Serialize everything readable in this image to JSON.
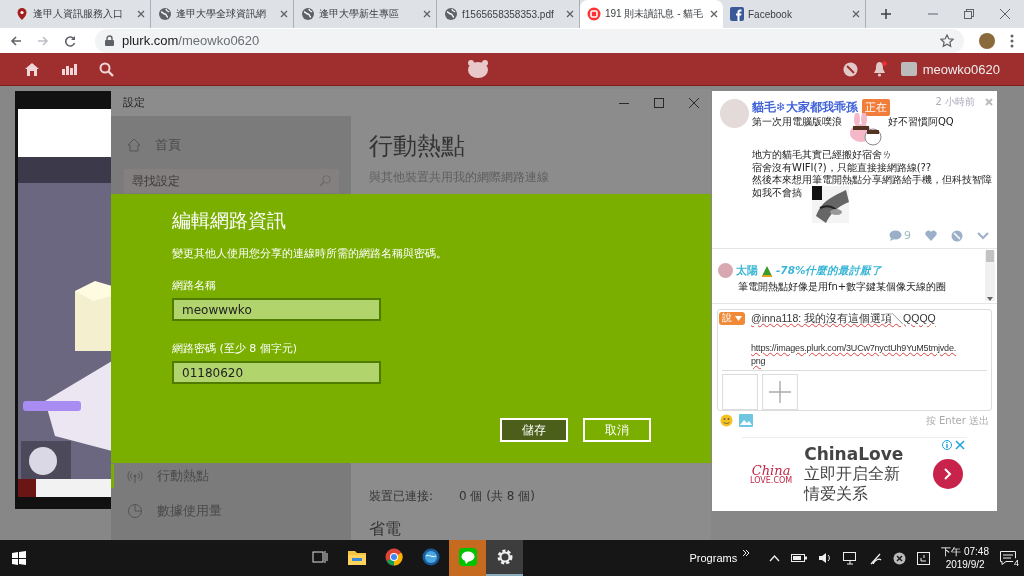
{
  "browser": {
    "tabs": [
      {
        "kind": "pin",
        "title": "逢甲人資訊服務入口",
        "selected": false
      },
      {
        "kind": "globe",
        "title": "逢甲大學全球資訊網",
        "selected": false
      },
      {
        "kind": "globe",
        "title": "逢甲大學新生專區",
        "selected": false
      },
      {
        "kind": "globe",
        "title": "f1565658358353.pdf",
        "selected": false
      },
      {
        "kind": "plurk",
        "title": "191 則未讀訊息 - 貓毛",
        "selected": true
      },
      {
        "kind": "facebook",
        "title": "Facebook",
        "selected": false
      }
    ],
    "address": {
      "host": "plurk.com",
      "path": "/meowko0620"
    }
  },
  "plurk_nav": {
    "username": "meowko0620"
  },
  "settings": {
    "title": "設定",
    "home": "首頁",
    "search_placeholder": "尋找設定",
    "nav_items": [
      {
        "kind": "hotspot",
        "label": "行動熱點",
        "selected": true
      },
      {
        "kind": "data",
        "label": "數據使用量",
        "selected": false
      }
    ],
    "page_title": "行動熱點",
    "page_subtitle": "與其他裝置共用我的網際網路連線",
    "connected_label": "裝置已連接:",
    "connected_value": "0 個 (共 8 個)",
    "section": "省電"
  },
  "dialog": {
    "title": "編輯網路資訊",
    "description": "變更其他人使用您分享的連線時所需的網路名稱與密碼。",
    "fields": [
      {
        "label": "網路名稱",
        "value": "meowwwko"
      },
      {
        "label": "網路密碼 (至少 8 個字元)",
        "value": "01180620"
      }
    ],
    "buttons": [
      {
        "label": "儲存",
        "primary": true
      },
      {
        "label": "取消",
        "primary": false
      }
    ]
  },
  "plurk": {
    "post": {
      "author": "貓毛❄大家都我乖孫",
      "qualifier": "正在",
      "time": "2 小時前",
      "lines": [
        "第一次用電腦版噗浪",
        "好不習慣阿QQ",
        "地方的貓毛其實已經搬好宿舍ㄌ",
        "宿舍沒有WIFI(?)，只能直接接網路線(??",
        "然後本來想用筆電開熱點分享網路給手機，但科技智障",
        "如我不會搞"
      ],
      "response_count": "9"
    },
    "response": {
      "author": "太陽",
      "nick_suffix": "-78%什麼的最討厭了",
      "text": "筆電開熱點好像是用fn+數字鍵某個像天線的圈"
    },
    "reply": {
      "qualifier": "說",
      "lines": [
        "@inna118: 我的沒有這個選項╲QQQQ",
        "https://images.plurk.com/3UCw7nyctUh9YuM5tmjvde.",
        "png"
      ],
      "hint": "按 Enter 送出"
    },
    "ad": {
      "logo_top": "China",
      "logo_bottom": "LOVE.COM",
      "brand": "ChinaLove",
      "lines": [
        "立即开启全新",
        "情爱关系"
      ]
    }
  },
  "taskbar": {
    "apps": [
      {
        "kind": "taskview",
        "selected": false,
        "flashing": false
      },
      {
        "kind": "explorer",
        "selected": false,
        "flashing": false
      },
      {
        "kind": "chrome",
        "selected": false,
        "flashing": false
      },
      {
        "kind": "globe",
        "selected": false,
        "flashing": false
      },
      {
        "kind": "line",
        "selected": false,
        "flashing": true
      },
      {
        "kind": "settings",
        "selected": true,
        "flashing": false
      }
    ],
    "toolbar_label": "Programs",
    "time": "下午 07:48",
    "date": "2019/9/2",
    "notifications": "4"
  }
}
